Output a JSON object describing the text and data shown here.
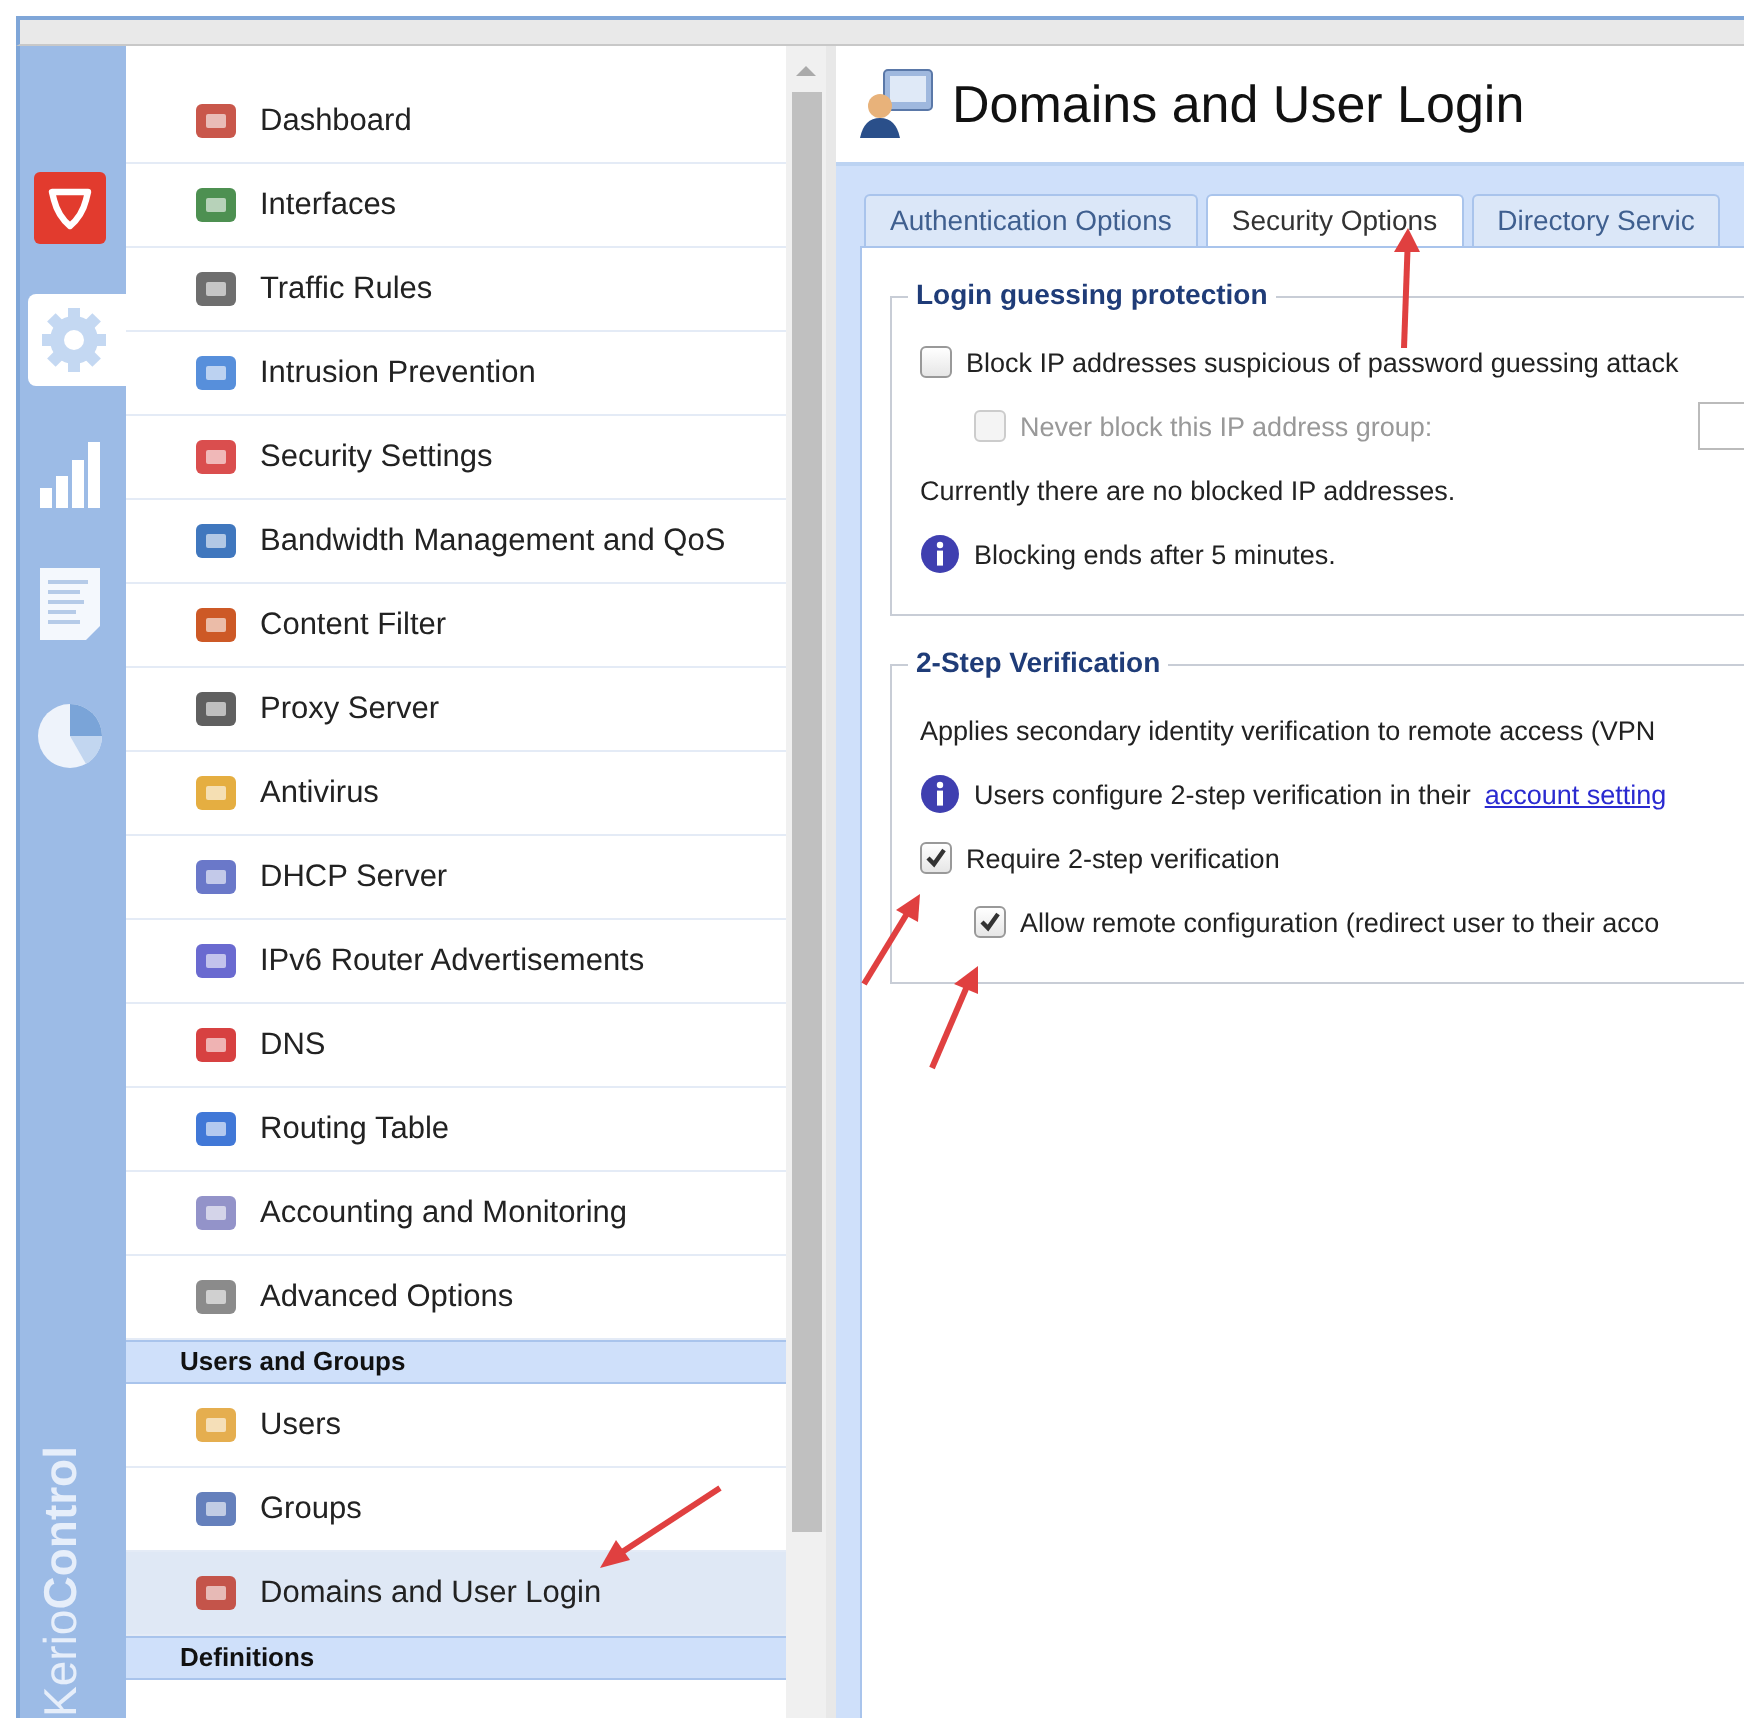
{
  "rail": {
    "items": [
      {
        "selected": false
      },
      {
        "selected": true
      },
      {
        "selected": false
      },
      {
        "selected": false
      },
      {
        "selected": false
      }
    ],
    "brand": "Kerio**Control**"
  },
  "menu": [
    {
      "kind": "item",
      "label": "Dashboard",
      "selected": false
    },
    {
      "kind": "item",
      "label": "Interfaces",
      "selected": false
    },
    {
      "kind": "item",
      "label": "Traffic Rules",
      "selected": false
    },
    {
      "kind": "item",
      "label": "Intrusion Prevention",
      "selected": false
    },
    {
      "kind": "item",
      "label": "Security Settings",
      "selected": false
    },
    {
      "kind": "item",
      "label": "Bandwidth Management and QoS",
      "selected": false
    },
    {
      "kind": "item",
      "label": "Content Filter",
      "selected": false
    },
    {
      "kind": "item",
      "label": "Proxy Server",
      "selected": false
    },
    {
      "kind": "item",
      "label": "Antivirus",
      "selected": false
    },
    {
      "kind": "item",
      "label": "DHCP Server",
      "selected": false
    },
    {
      "kind": "item",
      "label": "IPv6 Router Advertisements",
      "selected": false
    },
    {
      "kind": "item",
      "label": "DNS",
      "selected": false
    },
    {
      "kind": "item",
      "label": "Routing Table",
      "selected": false
    },
    {
      "kind": "item",
      "label": "Accounting and Monitoring",
      "selected": false
    },
    {
      "kind": "item",
      "label": "Advanced Options",
      "selected": false
    },
    {
      "kind": "header",
      "label": "Users and Groups"
    },
    {
      "kind": "item",
      "label": "Users",
      "selected": false
    },
    {
      "kind": "item",
      "label": "Groups",
      "selected": false
    },
    {
      "kind": "item",
      "label": "Domains and User Login",
      "selected": true
    },
    {
      "kind": "header",
      "label": "Definitions"
    }
  ],
  "page": {
    "title": "Domains and User Login",
    "tabs": [
      {
        "label": "Authentication Options",
        "selected": false
      },
      {
        "label": "Security Options",
        "selected": true
      },
      {
        "label": "Directory Servic",
        "selected": false
      }
    ],
    "sections": [
      {
        "title": "Login guessing protection",
        "rows": [
          {
            "kind": "checkbox",
            "label": "Block IP addresses suspicious of password guessing attack",
            "checked": false,
            "disabled": false
          },
          {
            "kind": "subcheckbox-select",
            "label": "Never block this IP address group:",
            "checked": false,
            "disabled": true
          },
          {
            "kind": "text",
            "label": "Currently there are no blocked IP addresses."
          },
          {
            "kind": "info",
            "label": "Blocking ends after 5 minutes."
          }
        ]
      },
      {
        "title": "2-Step Verification",
        "rows": [
          {
            "kind": "text",
            "label": "Applies secondary identity verification to remote access (VPN"
          },
          {
            "kind": "info",
            "label": "Users configure 2-step verification in their",
            "link": "account setting"
          },
          {
            "kind": "checkbox",
            "label": "Require 2-step verification",
            "checked": true,
            "disabled": false
          },
          {
            "kind": "subcheckbox",
            "label": "Allow remote configuration (redirect user to their acco",
            "checked": true,
            "disabled": false
          }
        ]
      }
    ]
  }
}
